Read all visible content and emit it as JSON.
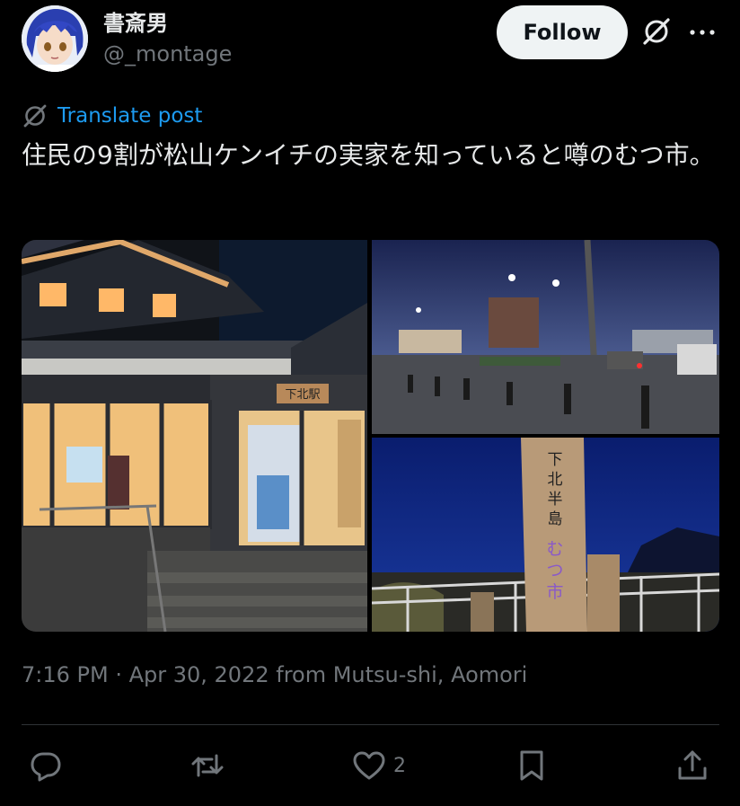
{
  "author": {
    "display_name": "書斎男",
    "handle": "@_montage",
    "avatar_icon": "anime-avatar-icon"
  },
  "header": {
    "follow_label": "Follow"
  },
  "translate": {
    "label": "Translate post"
  },
  "tweet": {
    "text": "住民の9割が松山ケンイチの実家を知っていると噂のむつ市。"
  },
  "media": {
    "photos": [
      {
        "description_icon": "station-building-photo",
        "sign_text": "下北駅"
      },
      {
        "description_icon": "night-parking-lot-photo"
      },
      {
        "description_icon": "signpost-photo",
        "sign_text": "下北半島 むつ市"
      }
    ]
  },
  "meta": {
    "timestamp": "7:16 PM · Apr 30, 2022 from Mutsu-shi, Aomori"
  },
  "actions": {
    "like_count": "2"
  },
  "colors": {
    "background": "#000000",
    "text": "#e7e9ea",
    "muted": "#71767b",
    "link": "#1d9bf0",
    "follow_bg": "#eff3f4"
  }
}
